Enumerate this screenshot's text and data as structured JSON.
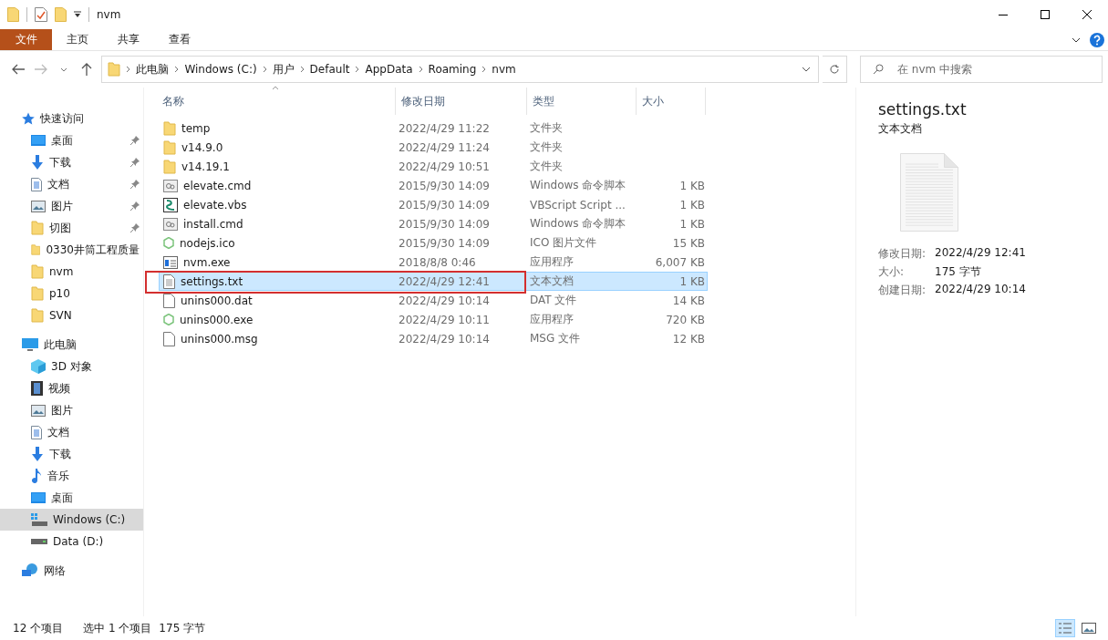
{
  "window": {
    "title": "nvm"
  },
  "ribbon_tabs": [
    {
      "label": "文件",
      "kind": "file",
      "selected": false
    },
    {
      "label": "主页",
      "kind": "tab",
      "selected": false
    },
    {
      "label": "共享",
      "kind": "tab",
      "selected": false
    },
    {
      "label": "查看",
      "kind": "tab",
      "selected": false
    }
  ],
  "breadcrumb": [
    "此电脑",
    "Windows (C:)",
    "用户",
    "Default",
    "AppData",
    "Roaming",
    "nvm"
  ],
  "search": {
    "placeholder": "在 nvm 中搜索"
  },
  "sidebar": [
    {
      "label": "快速访问",
      "kind": "star",
      "selected": false,
      "children": [
        {
          "label": "桌面",
          "kind": "desktop",
          "pinned": true,
          "selected": false
        },
        {
          "label": "下载",
          "kind": "download",
          "pinned": true,
          "selected": false
        },
        {
          "label": "文档",
          "kind": "doc",
          "pinned": true,
          "selected": false
        },
        {
          "label": "图片",
          "kind": "picture",
          "pinned": true,
          "selected": false
        },
        {
          "label": "切图",
          "kind": "folder",
          "pinned": true,
          "selected": false
        },
        {
          "label": "0330井筒工程质量",
          "kind": "folder",
          "pinned": false,
          "selected": false
        },
        {
          "label": "nvm",
          "kind": "folder",
          "pinned": false,
          "selected": false
        },
        {
          "label": "p10",
          "kind": "folder",
          "pinned": false,
          "selected": false
        },
        {
          "label": "SVN",
          "kind": "folder",
          "pinned": false,
          "selected": false
        }
      ]
    },
    {
      "label": "此电脑",
      "kind": "pc",
      "selected": false,
      "children": [
        {
          "label": "3D 对象",
          "kind": "cube",
          "pinned": false,
          "selected": false
        },
        {
          "label": "视频",
          "kind": "video",
          "pinned": false,
          "selected": false
        },
        {
          "label": "图片",
          "kind": "picture",
          "pinned": false,
          "selected": false
        },
        {
          "label": "文档",
          "kind": "doc",
          "pinned": false,
          "selected": false
        },
        {
          "label": "下载",
          "kind": "download",
          "pinned": false,
          "selected": false
        },
        {
          "label": "音乐",
          "kind": "music",
          "pinned": false,
          "selected": false
        },
        {
          "label": "桌面",
          "kind": "desktop",
          "pinned": false,
          "selected": false
        },
        {
          "label": "Windows (C:)",
          "kind": "drive-os",
          "pinned": false,
          "selected": true
        },
        {
          "label": "Data (D:)",
          "kind": "drive",
          "pinned": false,
          "selected": false
        }
      ]
    },
    {
      "label": "网络",
      "kind": "network",
      "selected": false
    }
  ],
  "table": {
    "columns": [
      "名称",
      "修改日期",
      "类型",
      "大小"
    ],
    "rows": [
      {
        "name": "temp",
        "date": "2022/4/29 11:22",
        "type": "文件夹",
        "kind": "folder",
        "selected": false,
        "outlined": false
      },
      {
        "name": "v14.9.0",
        "date": "2022/4/29 11:24",
        "type": "文件夹",
        "kind": "folder",
        "selected": false,
        "outlined": false
      },
      {
        "name": "v14.19.1",
        "date": "2022/4/29 10:51",
        "type": "文件夹",
        "kind": "folder",
        "selected": false,
        "outlined": false
      },
      {
        "name": "elevate.cmd",
        "date": "2015/9/30 14:09",
        "type": "Windows 命令脚本",
        "size": "1 KB",
        "kind": "cmd",
        "selected": false,
        "outlined": false
      },
      {
        "name": "elevate.vbs",
        "date": "2015/9/30 14:09",
        "type": "VBScript Script ...",
        "size": "1 KB",
        "kind": "vbs",
        "selected": false,
        "outlined": false
      },
      {
        "name": "install.cmd",
        "date": "2015/9/30 14:09",
        "type": "Windows 命令脚本",
        "size": "1 KB",
        "kind": "cmd",
        "selected": false,
        "outlined": false
      },
      {
        "name": "nodejs.ico",
        "date": "2015/9/30 14:09",
        "type": "ICO 图片文件",
        "size": "15 KB",
        "kind": "node",
        "selected": false,
        "outlined": false
      },
      {
        "name": "nvm.exe",
        "date": "2018/8/8 0:46",
        "type": "应用程序",
        "size": "6,007 KB",
        "kind": "exe",
        "selected": false,
        "outlined": false
      },
      {
        "name": "settings.txt",
        "date": "2022/4/29 12:41",
        "type": "文本文档",
        "size": "1 KB",
        "kind": "txt",
        "selected": true,
        "outlined": true
      },
      {
        "name": "unins000.dat",
        "date": "2022/4/29 10:14",
        "type": "DAT 文件",
        "size": "14 KB",
        "kind": "blank",
        "selected": false,
        "outlined": false
      },
      {
        "name": "unins000.exe",
        "date": "2022/4/29 10:11",
        "type": "应用程序",
        "size": "720 KB",
        "kind": "node",
        "selected": false,
        "outlined": false
      },
      {
        "name": "unins000.msg",
        "date": "2022/4/29 10:14",
        "type": "MSG 文件",
        "size": "12 KB",
        "kind": "blank",
        "selected": false,
        "outlined": false
      }
    ]
  },
  "details": {
    "title": "settings.txt",
    "subtitle": "文本文档",
    "fields": [
      {
        "label": "修改日期:",
        "value": "2022/4/29 12:41"
      },
      {
        "label": "大小:",
        "value": "175 字节"
      },
      {
        "label": "创建日期:",
        "value": "2022/4/29 10:14"
      }
    ]
  },
  "status_bar": {
    "count": "12 个项目",
    "selection": "选中 1 个项目",
    "size": "175 字节"
  },
  "view_buttons": [
    {
      "kind": "details",
      "selected": true
    },
    {
      "kind": "large",
      "selected": false
    }
  ]
}
